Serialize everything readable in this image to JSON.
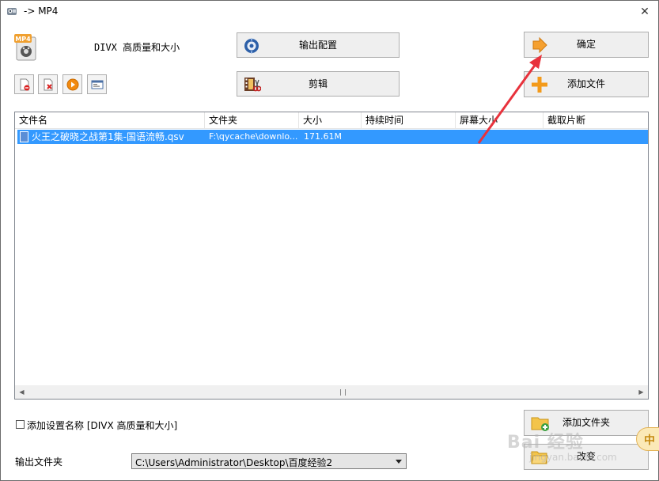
{
  "window": {
    "title": "-> MP4",
    "close_glyph": "✕"
  },
  "format": {
    "icon_text": "MP4",
    "label_prefix": "DIVX",
    "label_cjk": "高质量和大小"
  },
  "tools": [
    {
      "name": "remove-file-icon"
    },
    {
      "name": "clear-list-icon"
    },
    {
      "name": "play-icon"
    },
    {
      "name": "file-info-icon"
    }
  ],
  "buttons": {
    "output_config": "输出配置",
    "edit": "剪辑",
    "ok": "确定",
    "add_file": "添加文件",
    "add_folder": "添加文件夹",
    "change": "改变"
  },
  "list": {
    "columns": [
      "文件名",
      "文件夹",
      "大小",
      "持续时间",
      "屏幕大小",
      "截取片断"
    ],
    "rows": [
      {
        "filename": "火王之破晓之战第1集-国语流畅.qsv",
        "folder": "F:\\qycache\\downlo...",
        "size": "171.61M",
        "duration": "",
        "screen": "",
        "clip": ""
      }
    ]
  },
  "options": {
    "add_setting_name_label": "添加设置名称 [DIVX 高质量和大小]",
    "output_folder_label": "输出文件夹",
    "output_folder_value": "C:\\Users\\Administrator\\Desktop\\百度经验2"
  },
  "ime": {
    "label": "中"
  },
  "watermark": {
    "text": "Bai 经验",
    "sub": "jingyan.baidu.com"
  },
  "colors": {
    "selection": "#3399ff",
    "annotation_arrow": "#e8323c",
    "button_face": "#efefef"
  }
}
